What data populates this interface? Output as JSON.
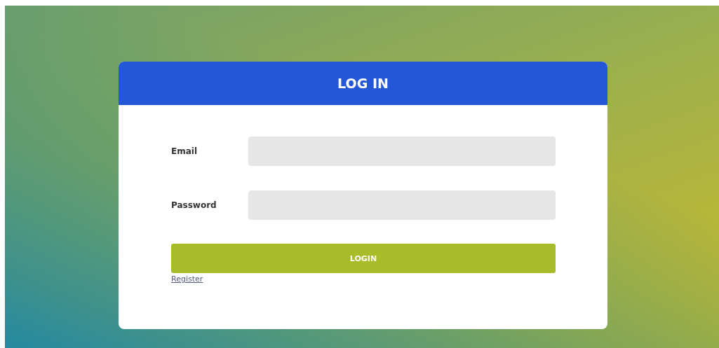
{
  "card": {
    "title": "LOG IN"
  },
  "fields": [
    {
      "label": "Email"
    },
    {
      "label": "Password"
    }
  ],
  "login_button": "LOGIN",
  "register_link": "Register"
}
